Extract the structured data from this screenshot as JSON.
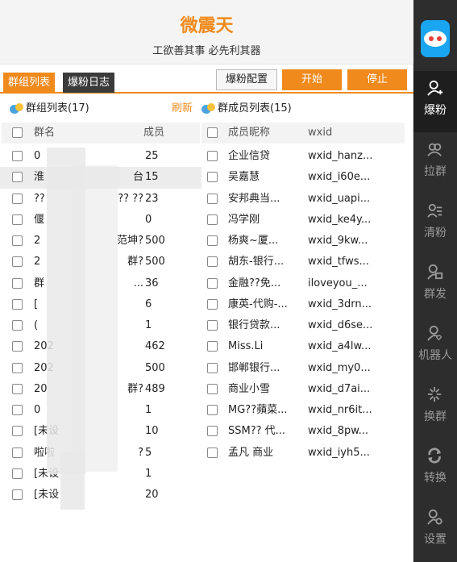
{
  "header": {
    "title": "微震天",
    "subtitle": "工欲善其事 必先利其器"
  },
  "tabs": [
    {
      "label": "群组列表",
      "active": true
    },
    {
      "label": "爆粉日志",
      "active": false
    }
  ],
  "toolbar": {
    "config_label": "爆粉配置",
    "start_label": "开始",
    "stop_label": "停止"
  },
  "groups": {
    "heading": "群组列表(17)",
    "refresh_label": "刷新",
    "col_name": "群名",
    "col_members": "成员",
    "rows": [
      {
        "name": "0",
        "members": "25"
      },
      {
        "name": "淮",
        "members": "15",
        "suffix": "台"
      },
      {
        "name": "??",
        "members": "23",
        "suffix": "?? ??"
      },
      {
        "name": "偃",
        "members": "0"
      },
      {
        "name": "2",
        "members": "500",
        "suffix": "范坤?"
      },
      {
        "name": "2",
        "members": "500",
        "suffix": "群?"
      },
      {
        "name": "群",
        "members": "36",
        "suffix": "..."
      },
      {
        "name": "[",
        "members": "6"
      },
      {
        "name": "(",
        "members": "1"
      },
      {
        "name": "202",
        "members": "462"
      },
      {
        "name": "202",
        "members": "500"
      },
      {
        "name": "20",
        "members": "489",
        "suffix": "群?"
      },
      {
        "name": "0",
        "members": "1"
      },
      {
        "name": "[未设",
        "members": "10"
      },
      {
        "name": "啦啦",
        "members": "5",
        "suffix": "?"
      },
      {
        "name": "[未设",
        "members": "1"
      },
      {
        "name": "[未设",
        "members": "20"
      }
    ]
  },
  "members": {
    "heading": "群成员列表(15)",
    "col_nickname": "成员昵称",
    "col_wxid": "wxid",
    "rows": [
      {
        "nickname": "企业信贷",
        "wxid": "wxid_hanz..."
      },
      {
        "nickname": "吴嘉慧",
        "wxid": "wxid_i60e..."
      },
      {
        "nickname": "安邦典当...",
        "wxid": "wxid_uapi..."
      },
      {
        "nickname": "冯学刚",
        "wxid": "wxid_ke4y..."
      },
      {
        "nickname": "杨爽~厦...",
        "wxid": "wxid_9kw..."
      },
      {
        "nickname": "胡东-银行...",
        "wxid": "wxid_tfws..."
      },
      {
        "nickname": "金融??免...",
        "wxid": "iloveyou_..."
      },
      {
        "nickname": "康英-代购-...",
        "wxid": "wxid_3drn..."
      },
      {
        "nickname": "银行贷款...",
        "wxid": "wxid_d6se..."
      },
      {
        "nickname": "Miss.Li",
        "wxid": "wxid_a4lw..."
      },
      {
        "nickname": "邯郸银行...",
        "wxid": "wxid_my0..."
      },
      {
        "nickname": "商业小雪",
        "wxid": "wxid_d7ai..."
      },
      {
        "nickname": "MG??蘋菜...",
        "wxid": "wxid_nr6it..."
      },
      {
        "nickname": "SSM?? 代...",
        "wxid": "wxid_8pw..."
      },
      {
        "nickname": "孟凡 商业",
        "wxid": "wxid_iyh5..."
      }
    ]
  },
  "sidebar": {
    "items": [
      {
        "label": "爆粉",
        "icon": "user-add-icon",
        "active": true
      },
      {
        "label": "拉群",
        "icon": "group-icon",
        "active": false
      },
      {
        "label": "清粉",
        "icon": "user-list-icon",
        "active": false
      },
      {
        "label": "群发",
        "icon": "user-message-icon",
        "active": false
      },
      {
        "label": "机器人",
        "icon": "user-heart-icon",
        "active": false
      },
      {
        "label": "换群",
        "icon": "sparkle-icon",
        "active": false
      },
      {
        "label": "转换",
        "icon": "sync-icon",
        "active": false
      },
      {
        "label": "设置",
        "icon": "user-gear-icon",
        "active": false
      }
    ]
  },
  "colors": {
    "accent": "#f08a1c",
    "sidebar_bg": "#2d2d2d",
    "logo_bg": "#1aa5f0"
  }
}
